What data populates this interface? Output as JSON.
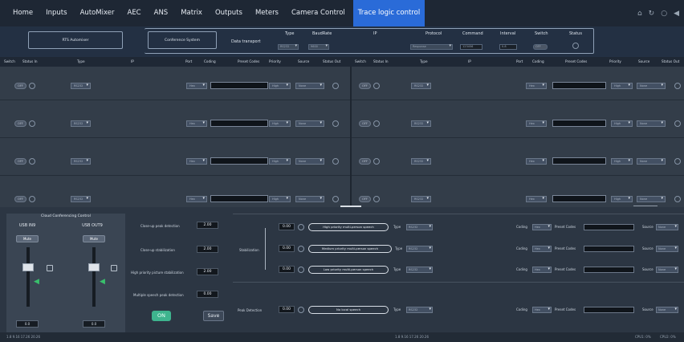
{
  "nav": {
    "tabs": [
      "Home",
      "Inputs",
      "AutoMixer",
      "AEC",
      "ANS",
      "Matrix",
      "Outputs",
      "Meters",
      "Camera Control",
      "Trace logic control"
    ],
    "active": "Trace logic control",
    "icons": [
      "home-icon",
      "refresh-icon",
      "lock-icon",
      "volume-icon"
    ]
  },
  "header": {
    "box1": "RTS Automixer",
    "box2": "Conference System",
    "data_transport": "Data transport",
    "type_label": "Type",
    "type_value": "RS232",
    "baud_label": "BaudRate",
    "baud_value": "9600",
    "ip_label": "IP",
    "protocol_label": "Protocol",
    "protocol_value": "Response",
    "command_label": "Command",
    "command_value": "123456",
    "interval_label": "Interval",
    "interval_value": "0.8",
    "switch_label": "Switch",
    "switch_value": "OFF",
    "status_label": "Status"
  },
  "columns": [
    "Switch",
    "Status In",
    "Type",
    "IP",
    "Port",
    "Coding",
    "Preset Codes",
    "Priority",
    "Source",
    "Status Out"
  ],
  "grid_rows": [
    {
      "switch": "OFF",
      "type": "RS232",
      "coding": "Hex",
      "priority": "High",
      "source": "None"
    },
    {
      "switch": "OFF",
      "type": "RS232",
      "coding": "Hex",
      "priority": "High",
      "source": "None"
    },
    {
      "switch": "OFF",
      "type": "RS232",
      "coding": "Hex",
      "priority": "High",
      "source": "None"
    },
    {
      "switch": "OFF",
      "type": "RS232",
      "coding": "Hex",
      "priority": "High",
      "source": "None"
    }
  ],
  "cloud": {
    "title": "Cloud Conferencing Control",
    "in_label": "USB IN9",
    "out_label": "USB OUT9",
    "mute": "Mute",
    "in_value": "0.0",
    "out_value": "0.0"
  },
  "params": [
    {
      "label": "Close-up peak detection",
      "value": "2.00"
    },
    {
      "label": "Close-up stabilization",
      "value": "2.00"
    },
    {
      "label": "High priority picture stabilization",
      "value": "2.00"
    },
    {
      "label": "Multiple speech peak detection",
      "value": "0.00"
    }
  ],
  "buttons": {
    "on": "ON",
    "save": "Save"
  },
  "stabilization": {
    "label": "Stabilization",
    "rows": [
      {
        "num": "0.00",
        "pill": "High priority multi-person speech",
        "type_label": "Type",
        "type": "RS232",
        "coding_label": "Coding",
        "coding": "Hex",
        "preset_label": "Preset Codes",
        "source_label": "Source",
        "source": "None"
      },
      {
        "num": "0.00",
        "pill": "Medium priority multi-person speech",
        "type_label": "Type",
        "type": "RS232",
        "coding_label": "Coding",
        "coding": "Hex",
        "preset_label": "Preset Codes",
        "source_label": "Source",
        "source": "None"
      },
      {
        "num": "0.00",
        "pill": "Low priority multi-person speech",
        "type_label": "Type",
        "type": "RS232",
        "coding_label": "Coding",
        "coding": "Hex",
        "preset_label": "Preset Codes",
        "source_label": "Source",
        "source": "None"
      }
    ]
  },
  "peak": {
    "label": "Peak Detection",
    "num": "0.00",
    "pill": "No local speech",
    "type_label": "Type",
    "type": "RS232",
    "coding_label": "Coding",
    "coding": "Hex",
    "preset_label": "Preset Codes",
    "source_label": "Source",
    "source": "None"
  },
  "status": {
    "left": "1.8  9.16  17.26  20.26",
    "mid": "1.8  9.16  17.26  20.26",
    "cpu1": "CPU1: 0%",
    "cpu2": "CPU2: 0%"
  }
}
